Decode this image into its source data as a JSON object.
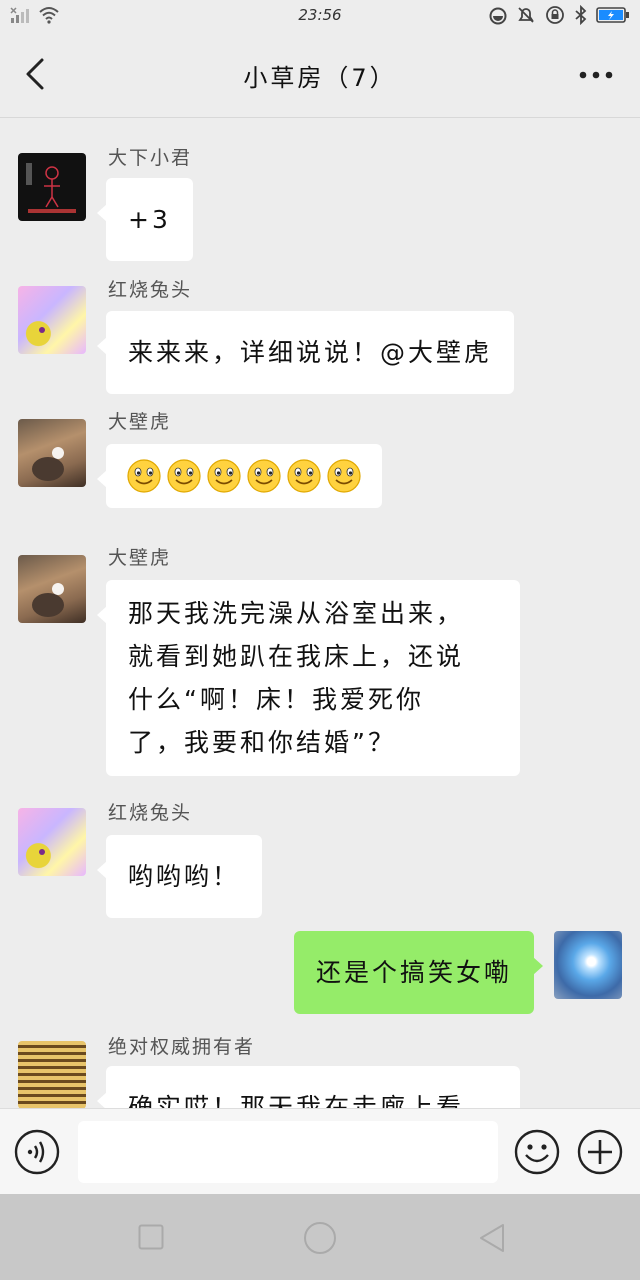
{
  "status_bar": {
    "time": "23:56",
    "icons": [
      "signal-icon",
      "wifi-icon",
      "alarm-icon",
      "mute-icon",
      "lock-rotation-icon",
      "bluetooth-icon",
      "battery-icon"
    ]
  },
  "header": {
    "title": "小草房（7）",
    "back_icon": "back-arrow-icon",
    "more_icon": "more-dots-icon"
  },
  "messages": [
    {
      "sender": "大下小君",
      "text": "+3",
      "side": "left",
      "avatar": "stick-figure-art"
    },
    {
      "sender": "红烧兔头",
      "text": "来来来，详细说说！@大壁虎",
      "side": "left",
      "avatar": "colorful-blob"
    },
    {
      "sender": "大壁虎",
      "emoji_count": 6,
      "emoji": "smile-emoji",
      "side": "left",
      "avatar": "bearded-man"
    },
    {
      "sender": "大壁虎",
      "lines": [
        "那天我洗完澡从浴室出来，",
        "就看到她趴在我床上，还说",
        "什么“啊！床！我爱死你",
        "了，我要和你结婚”？"
      ],
      "side": "left",
      "avatar": "bearded-man"
    },
    {
      "sender": "红烧兔头",
      "text": "哟哟哟！",
      "side": "left",
      "avatar": "colorful-blob"
    },
    {
      "text": "还是个搞笑女嘞",
      "side": "right",
      "avatar": "blue-light"
    },
    {
      "sender": "绝对权威拥有者",
      "text": "确实哎！那天我在走廊上看",
      "side": "left",
      "avatar": "gold-stripes"
    }
  ],
  "input_bar": {
    "voice_icon": "voice-icon",
    "emoji_icon": "emoji-icon",
    "plus_icon": "plus-icon",
    "value": ""
  },
  "system_nav": {
    "recent_icon": "recent-apps-icon",
    "home_icon": "home-icon",
    "back_icon": "system-back-icon"
  }
}
